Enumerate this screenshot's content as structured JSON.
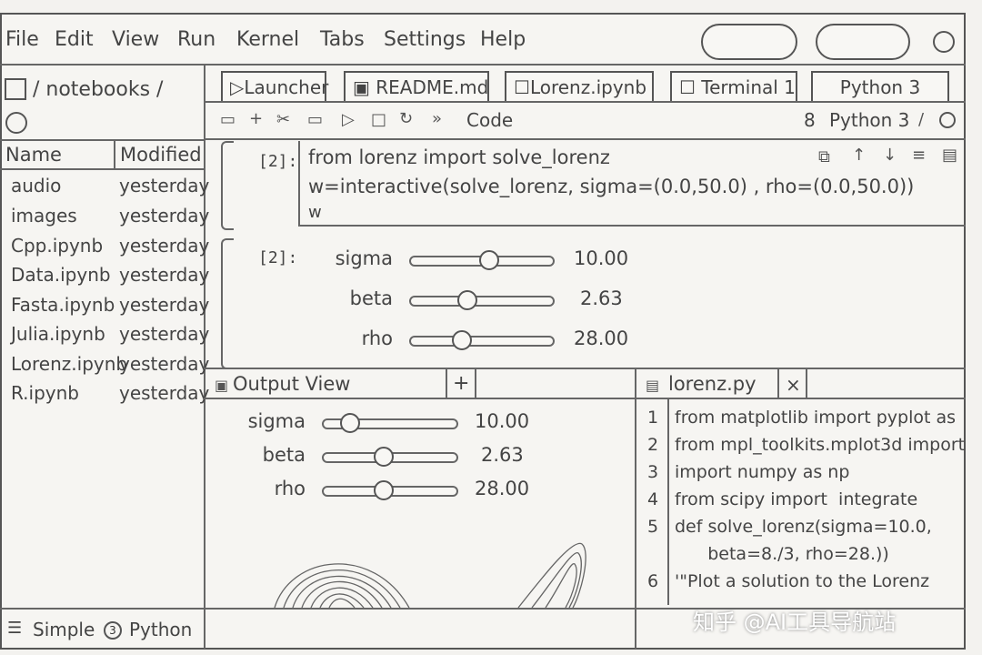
{
  "menu": [
    "File",
    "Edit",
    "View",
    "Run",
    "Kernel",
    "Tabs",
    "Settings",
    "Help"
  ],
  "sidebar": {
    "path": "/ notebooks /",
    "col_name": "Name",
    "col_modified": "Modified",
    "files": [
      {
        "name": "audio",
        "modified": "yesterday"
      },
      {
        "name": "images",
        "modified": "yesterday"
      },
      {
        "name": "Cpp.ipynb",
        "modified": "yesterday"
      },
      {
        "name": "Data.ipynb",
        "modified": "yesterday"
      },
      {
        "name": "Fasta.ipynb",
        "modified": "yesterday"
      },
      {
        "name": "Julia.ipynb",
        "modified": "yesterday"
      },
      {
        "name": "Lorenz.ipynb",
        "modified": "yesterday"
      },
      {
        "name": "R.ipynb",
        "modified": "yesterday"
      }
    ]
  },
  "tabs": [
    "Launcher",
    "README.md",
    "Lorenz.ipynb",
    "Terminal 1",
    "Python 3"
  ],
  "toolbar": {
    "cell_type": "Code",
    "kernel": "Python 3",
    "kernel_prefix": "8"
  },
  "cell1": {
    "prompt": "[2]:",
    "lines": [
      "from lorenz import solve_lorenz",
      "w=interactive(solve_lorenz, sigma=(0.0,50.0) , rho=(0.0,50.0))",
      "w"
    ]
  },
  "cell2": {
    "prompt": "[2]:",
    "sliders": [
      {
        "label": "sigma",
        "value": "10.00",
        "fraction": 0.55
      },
      {
        "label": "beta",
        "value": "2.63",
        "fraction": 0.4
      },
      {
        "label": "rho",
        "value": "28.00",
        "fraction": 0.36
      }
    ]
  },
  "output_view": {
    "title": "Output View",
    "plus": "+",
    "sliders": [
      {
        "label": "sigma",
        "value": "10.00",
        "fraction": 0.2
      },
      {
        "label": "beta",
        "value": "2.63",
        "fraction": 0.45
      },
      {
        "label": "rho",
        "value": "28.00",
        "fraction": 0.45
      }
    ]
  },
  "editor": {
    "title": "lorenz.py",
    "close": "×",
    "lines": [
      {
        "num": "1",
        "code": "from matplotlib import pyplot as"
      },
      {
        "num": "2",
        "code": "from mpl_toolkits.mplot3d import"
      },
      {
        "num": "3",
        "code": "import numpy as np"
      },
      {
        "num": "4",
        "code": "from scipy import  integrate"
      },
      {
        "num": "5",
        "code": "def solve_lorenz(sigma=10.0,"
      },
      {
        "num": "",
        "code": "      beta=8./3, rho=28.))"
      },
      {
        "num": "6",
        "code": "'\"Plot a solution to the Lorenz"
      }
    ]
  },
  "status": {
    "mode": "Simple",
    "kernel_count": "3",
    "kernel": "Python"
  },
  "watermark": "知乎 @AI工具导航站"
}
